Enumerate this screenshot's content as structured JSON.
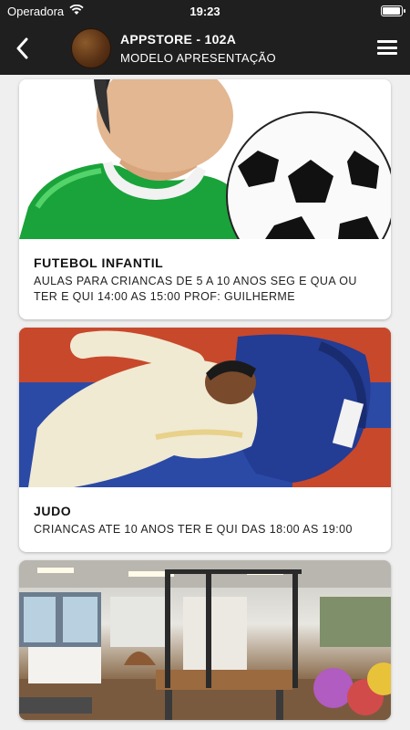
{
  "status": {
    "carrier": "Operadora",
    "time": "19:23",
    "battery_level": 0.95
  },
  "header": {
    "title": "APPSTORE - 102A",
    "subtitle": "MODELO APRESENTAÇÃO",
    "back_icon": "chevron-left-icon",
    "menu_icon": "hamburger-menu-icon"
  },
  "cards": [
    {
      "title": "FUTEBOL INFANTIL",
      "description": "AULAS PARA CRIANCAS DE 5 A 10 ANOS SEG E QUA OU TER E QUI 14:00 AS 15:00 PROF: GUILHERME"
    },
    {
      "title": "JUDO",
      "description": "CRIANCAS ATE 10 ANOS TER E QUI DAS 18:00 AS 19:00"
    },
    {
      "title": "",
      "description": ""
    }
  ],
  "colors": {
    "bar": "#1f1f1f",
    "background": "#efefef",
    "card": "#ffffff"
  }
}
